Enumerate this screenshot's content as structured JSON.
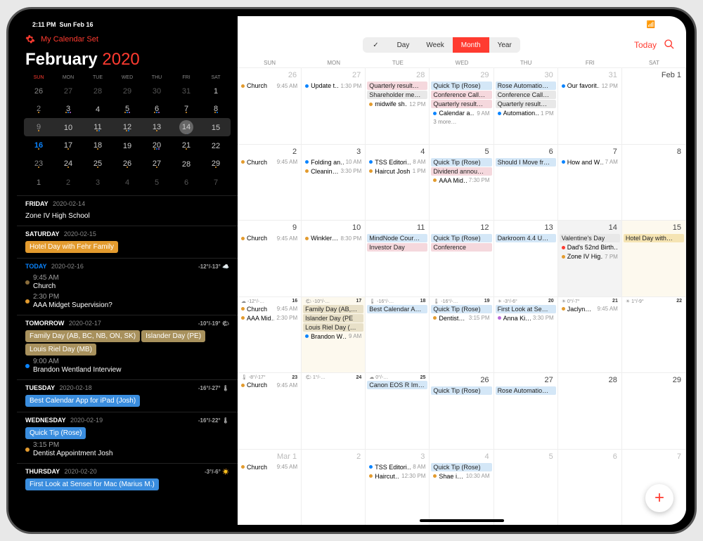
{
  "status": {
    "time": "2:11 PM",
    "date": "Sun Feb 16"
  },
  "header": {
    "calendar_set": "My Calendar Set",
    "month": "February",
    "year": "2020"
  },
  "dow_short": [
    "SUN",
    "MON",
    "TUE",
    "WED",
    "THU",
    "FRI",
    "SAT"
  ],
  "mini_weeks": [
    [
      {
        "n": "26",
        "out": true
      },
      {
        "n": "27",
        "out": true
      },
      {
        "n": "28",
        "out": true
      },
      {
        "n": "29",
        "out": true
      },
      {
        "n": "30",
        "out": true
      },
      {
        "n": "31",
        "out": true
      },
      {
        "n": "1"
      }
    ],
    [
      {
        "n": "2"
      },
      {
        "n": "3"
      },
      {
        "n": "4"
      },
      {
        "n": "5"
      },
      {
        "n": "6"
      },
      {
        "n": "7"
      },
      {
        "n": "8"
      }
    ],
    [
      {
        "n": "9"
      },
      {
        "n": "10"
      },
      {
        "n": "11"
      },
      {
        "n": "12"
      },
      {
        "n": "13"
      },
      {
        "n": "14",
        "sel": true
      },
      {
        "n": "15"
      }
    ],
    [
      {
        "n": "16",
        "today": true
      },
      {
        "n": "17"
      },
      {
        "n": "18"
      },
      {
        "n": "19"
      },
      {
        "n": "20"
      },
      {
        "n": "21"
      },
      {
        "n": "22"
      }
    ],
    [
      {
        "n": "23"
      },
      {
        "n": "24"
      },
      {
        "n": "25"
      },
      {
        "n": "26"
      },
      {
        "n": "27"
      },
      {
        "n": "28"
      },
      {
        "n": "29"
      }
    ],
    [
      {
        "n": "1",
        "out": true
      },
      {
        "n": "2",
        "out": true
      },
      {
        "n": "3",
        "out": true
      },
      {
        "n": "4",
        "out": true
      },
      {
        "n": "5",
        "out": true
      },
      {
        "n": "6",
        "out": true
      },
      {
        "n": "7",
        "out": true
      }
    ]
  ],
  "agenda": [
    {
      "label": "FRIDAY",
      "date": "2020-02-14",
      "events": [
        {
          "text": "Zone IV High School",
          "dim": true
        }
      ]
    },
    {
      "label": "SATURDAY",
      "date": "2020-02-15",
      "events": [
        {
          "pill": true,
          "bg": "#e39b2e",
          "fg": "#fff",
          "text": "Hotel Day with Fehr Family"
        }
      ]
    },
    {
      "label": "TODAY",
      "date": "2020-02-16",
      "today": true,
      "weather": "-12°/-13° ☁️",
      "events": [
        {
          "dot": "#8a6d3b",
          "time": "9:45 AM",
          "text": "Church",
          "dim": true
        },
        {
          "dot": "#e39b2e",
          "time": "2:30 PM",
          "text": "AAA Midget Supervision?"
        }
      ]
    },
    {
      "label": "TOMORROW",
      "date": "2020-02-17",
      "weather": "-10°/-19° 🌤",
      "events": [
        {
          "pill": true,
          "bg": "#a8915d",
          "fg": "#fff",
          "text": "Family Day (AB, BC, NB, ON, SK)"
        },
        {
          "pill": true,
          "bg": "#a8915d",
          "fg": "#fff",
          "text": "Islander Day (PE)"
        },
        {
          "pill": true,
          "bg": "#a8915d",
          "fg": "#fff",
          "text": "Louis Riel Day (MB)"
        },
        {
          "dot": "#0a84ff",
          "time": "9:00 AM",
          "text": "Brandon Wentland Interview"
        }
      ]
    },
    {
      "label": "TUESDAY",
      "date": "2020-02-18",
      "weather": "-16°/-27° 🌡",
      "events": [
        {
          "pill": true,
          "bg": "#3a8dde",
          "fg": "#fff",
          "text": "Best Calendar App for iPad (Josh)"
        }
      ]
    },
    {
      "label": "WEDNESDAY",
      "date": "2020-02-19",
      "weather": "-16°/-22° 🌡",
      "events": [
        {
          "pill": true,
          "bg": "#3a8dde",
          "fg": "#fff",
          "text": "Quick Tip (Rose)"
        },
        {
          "dot": "#e39b2e",
          "time": "3:15 PM",
          "text": "Dentist Appointment Josh"
        }
      ]
    },
    {
      "label": "THURSDAY",
      "date": "2020-02-20",
      "weather": "-3°/-6° ☀️",
      "events": [
        {
          "pill": true,
          "bg": "#3a8dde",
          "fg": "#fff",
          "text": "First Look at Sensei for Mac (Marius M.)"
        }
      ]
    }
  ],
  "segments": {
    "check": "✓",
    "day": "Day",
    "week": "Week",
    "month": "Month",
    "year": "Year"
  },
  "today_btn": "Today",
  "colors": {
    "blue": "#d4e7f7",
    "blue_d": "#2a72c4",
    "pink": "#f5d8dd",
    "pink_d": "#c15a6c",
    "gray": "#e8e8e8",
    "gray_d": "#777",
    "tan": "#e8e0c8",
    "tan_d": "#8a6d3b",
    "orange": "#f0a830",
    "green": "#3cb371",
    "purple": "#b96ad9",
    "red": "#ff3b30",
    "yellow": "#fff2cc"
  },
  "month_cells": [
    {
      "n": "26",
      "out": true,
      "events": [
        {
          "dot": "#e39b2e",
          "text": "Church",
          "time": "9:45 AM"
        }
      ]
    },
    {
      "n": "27",
      "out": true,
      "events": [
        {
          "dot": "#0a84ff",
          "text": "Update t…",
          "time": "1:30 PM"
        }
      ]
    },
    {
      "n": "28",
      "out": true,
      "events": [
        {
          "bar": "#f5d8dd",
          "text": "Quarterly result…"
        },
        {
          "bar": "#e8e8e8",
          "text": "Shareholder me…"
        },
        {
          "dot": "#e39b2e",
          "text": "midwife sh…",
          "time": "12 PM"
        }
      ]
    },
    {
      "n": "29",
      "out": true,
      "events": [
        {
          "bar": "#d4e7f7",
          "text": "Quick Tip (Rose)"
        },
        {
          "bar": "#f5d8dd",
          "text": "Conference Call…"
        },
        {
          "bar": "#f5d8dd",
          "text": "Quarterly result…"
        },
        {
          "dot": "#0a84ff",
          "text": "Calendar a…",
          "time": "9 AM"
        },
        {
          "more": "3 more…"
        }
      ]
    },
    {
      "n": "30",
      "out": true,
      "events": [
        {
          "bar": "#d4e7f7",
          "text": "Rose Automatio…"
        },
        {
          "bar": "#e8e8e8",
          "text": "Conference Call…"
        },
        {
          "bar": "#e8e8e8",
          "text": "Quarterly result…"
        },
        {
          "dot": "#0a84ff",
          "text": "Automation…",
          "time": "1 PM"
        }
      ]
    },
    {
      "n": "31",
      "out": true,
      "events": [
        {
          "dot": "#0a84ff",
          "text": "Our favorit…",
          "time": "12 PM"
        }
      ]
    },
    {
      "n": "Feb 1",
      "events": []
    },
    {
      "n": "2",
      "events": [
        {
          "dot": "#e39b2e",
          "text": "Church",
          "time": "9:45 AM"
        }
      ]
    },
    {
      "n": "3",
      "events": [
        {
          "dot": "#0a84ff",
          "text": "Folding an…",
          "time": "10 AM"
        },
        {
          "dot": "#e39b2e",
          "text": "Cleanin…",
          "time": "3:30 PM"
        }
      ]
    },
    {
      "n": "4",
      "events": [
        {
          "dot": "#0a84ff",
          "text": "TSS Editori…",
          "time": "8 AM"
        },
        {
          "dot": "#e39b2e",
          "text": "Haircut Josh",
          "time": "1 PM"
        }
      ]
    },
    {
      "n": "5",
      "events": [
        {
          "bar": "#d4e7f7",
          "text": "Quick Tip (Rose)"
        },
        {
          "bar": "#f5d8dd",
          "text": "Dividend annou…"
        },
        {
          "dot": "#e39b2e",
          "text": "AAA Mid…",
          "time": "7:30 PM"
        }
      ]
    },
    {
      "n": "6",
      "events": [
        {
          "bar": "#d4e7f7",
          "text": "Should I Move fr…"
        }
      ]
    },
    {
      "n": "7",
      "events": [
        {
          "dot": "#0a84ff",
          "text": "How and W…",
          "time": "7 AM"
        }
      ]
    },
    {
      "n": "8",
      "events": []
    },
    {
      "n": "9",
      "events": [
        {
          "dot": "#e39b2e",
          "text": "Church",
          "time": "9:45 AM"
        }
      ]
    },
    {
      "n": "10",
      "events": [
        {
          "dot": "#e39b2e",
          "text": "Winkler…",
          "time": "8:30 PM"
        }
      ]
    },
    {
      "n": "11",
      "events": [
        {
          "bar": "#d4e7f7",
          "text": "MindNode Cour…"
        },
        {
          "bar": "#f5d8dd",
          "text": "Investor Day"
        }
      ]
    },
    {
      "n": "12",
      "events": [
        {
          "bar": "#d4e7f7",
          "text": "Quick Tip (Rose)"
        },
        {
          "bar": "#f5d8dd",
          "text": "Conference"
        }
      ]
    },
    {
      "n": "13",
      "events": [
        {
          "bar": "#d4e7f7",
          "text": "Darkroom 4.4 U…"
        }
      ]
    },
    {
      "n": "14",
      "sel": true,
      "events": [
        {
          "bar": "#e8e8e8",
          "text": "Valentine's Day"
        },
        {
          "dot": "#ff3b30",
          "text": "Dad's 52nd Birth…"
        },
        {
          "dot": "#e39b2e",
          "text": "Zone IV Hig…",
          "time": "7 PM"
        }
      ]
    },
    {
      "n": "15",
      "hol": true,
      "events": [
        {
          "bar": "#f5e4b3",
          "text": "Hotel Day with…"
        }
      ]
    },
    {
      "n": "16",
      "today": true,
      "weather": "☁ -12°/-…",
      "events": [
        {
          "dot": "#e39b2e",
          "text": "Church",
          "time": "9:45 AM"
        },
        {
          "dot": "#e39b2e",
          "text": "AAA Mid…",
          "time": "2:30 PM"
        }
      ]
    },
    {
      "n": "17",
      "hol": true,
      "weather": "🌤 -10°/-…",
      "events": [
        {
          "bar": "#e8e0c8",
          "text": "Family Day (AB,…"
        },
        {
          "bar": "#e8e0c8",
          "text": "Islander Day (PE"
        },
        {
          "bar": "#e8e0c8",
          "text": "Louis Riel Day (…"
        },
        {
          "dot": "#0a84ff",
          "text": "Brandon W…",
          "time": "9 AM"
        }
      ]
    },
    {
      "n": "18",
      "weather": "🌡 -16°/-…",
      "events": [
        {
          "bar": "#d4e7f7",
          "text": "Best Calendar A…"
        }
      ]
    },
    {
      "n": "19",
      "weather": "🌡 -16°/-…",
      "events": [
        {
          "bar": "#d4e7f7",
          "text": "Quick Tip (Rose)"
        },
        {
          "dot": "#e39b2e",
          "text": "Dentist…",
          "time": "3:15 PM"
        }
      ]
    },
    {
      "n": "20",
      "weather": "☀ -3°/-6°",
      "events": [
        {
          "bar": "#d4e7f7",
          "text": "First Look at Se…"
        },
        {
          "dot": "#b96ad9",
          "text": "Anna Ki…",
          "time": "3:30 PM"
        }
      ]
    },
    {
      "n": "21",
      "weather": "☀ 0°/-7°",
      "events": [
        {
          "dot": "#e39b2e",
          "text": "Jaclyn…",
          "time": "9:45 AM"
        }
      ]
    },
    {
      "n": "22",
      "weather": "☀ 1°/-9°",
      "events": []
    },
    {
      "n": "23",
      "weather": "🌡 -8°/-17°",
      "events": [
        {
          "dot": "#e39b2e",
          "text": "Church",
          "time": "9:45 AM"
        }
      ]
    },
    {
      "n": "24",
      "weather": "🌤 1°/-…",
      "events": []
    },
    {
      "n": "25",
      "weather": "☁ 0°/-…",
      "events": [
        {
          "bar": "#d4e7f7",
          "text": "Canon EOS R Im…"
        }
      ]
    },
    {
      "n": "26",
      "events": [
        {
          "bar": "#d4e7f7",
          "text": "Quick Tip (Rose)"
        }
      ]
    },
    {
      "n": "27",
      "events": [
        {
          "bar": "#d4e7f7",
          "text": "Rose Automatio…"
        }
      ]
    },
    {
      "n": "28",
      "events": []
    },
    {
      "n": "29",
      "events": []
    },
    {
      "n": "Mar 1",
      "out": true,
      "events": [
        {
          "dot": "#e39b2e",
          "text": "Church",
          "time": "9:45 AM"
        }
      ]
    },
    {
      "n": "2",
      "out": true,
      "events": []
    },
    {
      "n": "3",
      "out": true,
      "events": [
        {
          "dot": "#0a84ff",
          "text": "TSS Editori…",
          "time": "8 AM"
        },
        {
          "dot": "#e39b2e",
          "text": "Haircut…",
          "time": "12:30 PM"
        }
      ]
    },
    {
      "n": "4",
      "out": true,
      "events": [
        {
          "bar": "#d4e7f7",
          "text": "Quick Tip (Rose)"
        },
        {
          "dot": "#e39b2e",
          "text": "Shae i…",
          "time": "10:30 AM"
        }
      ]
    },
    {
      "n": "5",
      "out": true,
      "events": []
    },
    {
      "n": "6",
      "out": true,
      "events": []
    },
    {
      "n": "7",
      "out": true,
      "events": []
    }
  ]
}
